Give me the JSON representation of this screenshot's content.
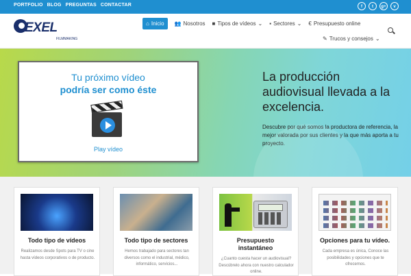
{
  "topbar": {
    "links": [
      "PORTFOLIO",
      "BLOG",
      "PREGUNTAS",
      "CONTACTAR"
    ],
    "social_icons": [
      "facebook-icon",
      "twitter-icon",
      "google-plus-icon",
      "vimeo-icon"
    ],
    "social_glyphs": [
      "f",
      "t",
      "g+",
      "v"
    ]
  },
  "logo": {
    "text": "EXEL",
    "sub": "FILMMAKING"
  },
  "nav": {
    "items": [
      {
        "label": "Inicio",
        "icon": "home-icon",
        "active": true
      },
      {
        "label": "Nosotros",
        "icon": "users-icon"
      },
      {
        "label": "Tipos de vídeos",
        "icon": "video-camera-icon",
        "dropdown": true
      },
      {
        "label": "Sectores",
        "icon": "briefcase-icon",
        "dropdown": true
      },
      {
        "label": "Presupuesto online",
        "icon": "euro-icon"
      },
      {
        "label": "Trucos y consejos",
        "icon": "magic-wand-icon",
        "dropdown": true
      }
    ]
  },
  "hero": {
    "video_title_line1": "Tu próximo vídeo",
    "video_title_line2": "podría ser como éste",
    "play_label": "Play vídeo",
    "heading": "La producción audiovisual llevada a la excelencia.",
    "subtext": "Descubre por qué somos la productora de referencia, la mejor valorada por sus clientes y la que más aporta a tu proyecto."
  },
  "features": [
    {
      "title": "Todo tipo de vídeos",
      "desc": "Realizamos desde Spots para TV o cine hasta vídeos corporativos o de producto."
    },
    {
      "title": "Todo tipo de sectores",
      "desc": "Hemos trabajado para sectores tan diversos como el industrial, médico, informático, servicios..."
    },
    {
      "title": "Presupuesto instantáneo",
      "desc": "¿Cuanto cuesta hacer un audiovisual? Descúbrelo ahora con nuestro calculador online."
    },
    {
      "title": "Opciones para tu vídeo.",
      "desc": "Cada empresa es única, Conoce las posibilidades y opciones que te ofrecemos."
    }
  ],
  "colors": {
    "brand_blue": "#1f8fd0",
    "logo_navy": "#1a2f6b"
  }
}
